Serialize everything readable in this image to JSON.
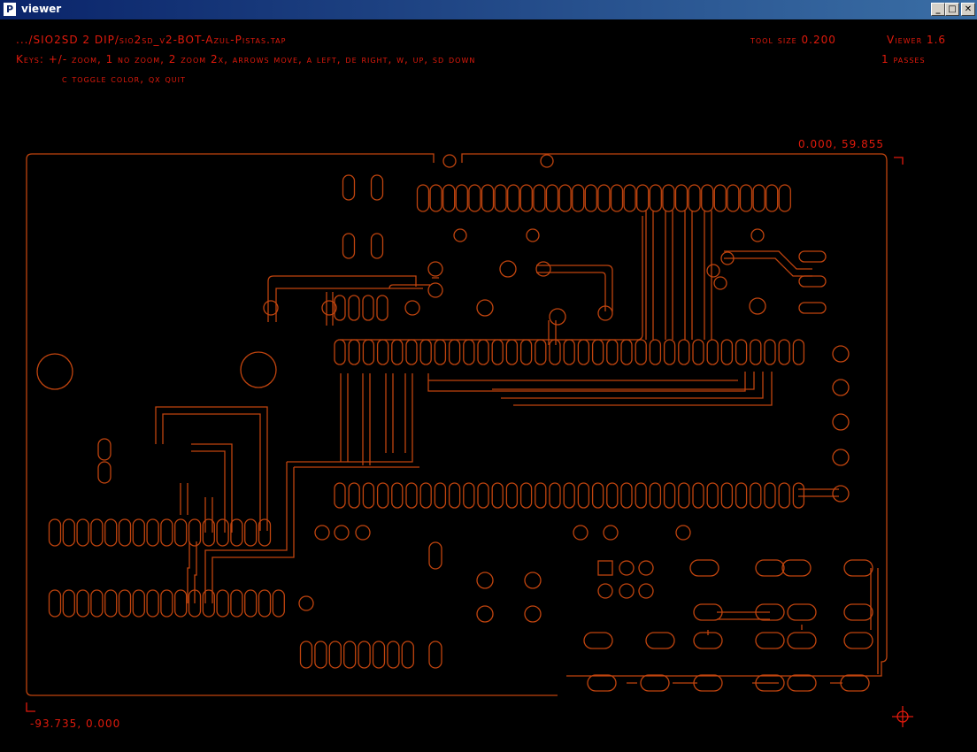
{
  "window": {
    "title": "viewer",
    "icon_glyph": "P"
  },
  "controls": {
    "minimize": "_",
    "maximize": "□",
    "close": "✕"
  },
  "hud": {
    "file_path": ".../SIO2SD 2 DIP/sio2sd_v2-BOT-Azul-Pistas.tap",
    "keys_line1": "Keys: +/- zoom, 1 no zoom, 2 zoom 2x, arrows move, a left, de right, w, up, sd down",
    "keys_line2": "c toggle color, qx quit",
    "tool_size": "tool size 0.200",
    "version": "Viewer 1.6",
    "passes": "1 passes",
    "coord_top_right": "0.000, 59.855",
    "coord_bottom_left": "-93.735, 0.000"
  },
  "colors": {
    "trace": "#c0440e",
    "hud_text": "#e01a0c",
    "background": "#000000",
    "titlebar": "#0a246a"
  },
  "icons": {
    "origin_marker": "crosshair-icon",
    "corner_marks": "corner-mark-icon"
  }
}
